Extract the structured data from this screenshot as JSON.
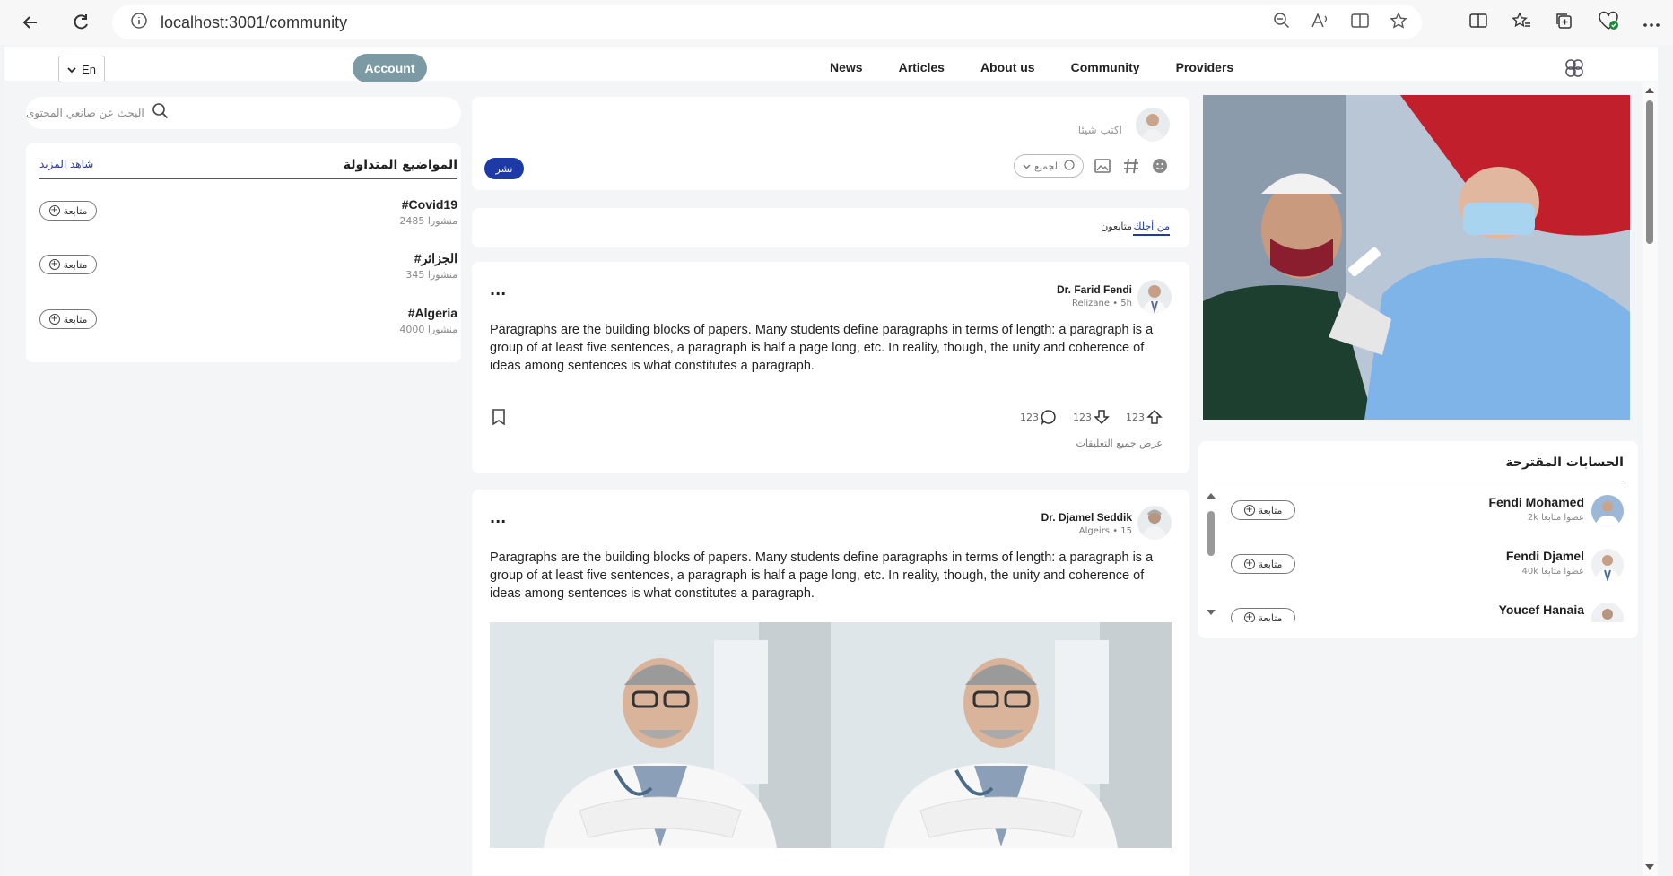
{
  "browser": {
    "url": "localhost:3001/community"
  },
  "nav": {
    "lang": "En",
    "account": "Account",
    "menu": [
      "News",
      "Articles",
      "About us",
      "Community",
      "Providers"
    ]
  },
  "search": {
    "placeholder": "البحث عن صانعي المحتوى"
  },
  "trends": {
    "title": "المواضيع المتداولة",
    "see_more": "شاهد المزيد",
    "follow_label": "متابعة",
    "items": [
      {
        "tag": "#Covid19",
        "count": "2485 منشورا"
      },
      {
        "tag": "#الجزائر",
        "count": "345 منشورا"
      },
      {
        "tag": "#Algeria",
        "count": "4000 منشورا"
      }
    ]
  },
  "composer": {
    "placeholder": "اكتب شيئا",
    "audience": "الجميع",
    "post_button": "نشر"
  },
  "feed_tabs": {
    "for_you": "من أجلك",
    "following": "متابعون"
  },
  "posts": [
    {
      "author": "Dr. Farid Fendi",
      "meta": "Relizane • 5h",
      "text": "Paragraphs are the building blocks of papers. Many students define paragraphs in terms of length: a paragraph is a group of at least five sentences, a paragraph is half a page long, etc. In reality, though, the unity and coherence of ideas among sentences is what constitutes a paragraph.",
      "upvotes": "123",
      "downvotes": "123",
      "comments": "123",
      "view_comments": "عرض جميع التعليقات"
    },
    {
      "author": "Dr. Djamel Seddik",
      "meta": "Algeirs • 15",
      "text": "Paragraphs are the building blocks of papers. Many students define paragraphs in terms of length: a paragraph is a group of at least five sentences, a paragraph is half a page long, etc. In reality, though, the unity and coherence of ideas among sentences is what constitutes a paragraph."
    }
  ],
  "suggested": {
    "title": "الحسابات المقترحة",
    "follow_label": "متابعة",
    "items": [
      {
        "name": "Fendi Mohamed",
        "sub": "2k عضوا متابعا"
      },
      {
        "name": "Fendi Djamel",
        "sub": "40k عضوا متابعا"
      },
      {
        "name": "Youcef Hanaia",
        "sub": ""
      }
    ]
  },
  "colors": {
    "accent": "#1d3aa7",
    "account_btn": "#7c9aa3"
  }
}
